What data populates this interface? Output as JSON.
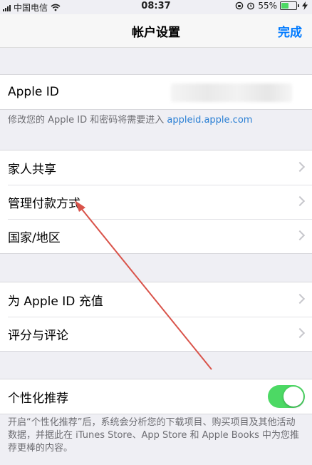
{
  "status": {
    "carrier": "中国电信",
    "time": "08:37",
    "battery": "55%",
    "battery_level": 0.55
  },
  "nav": {
    "title": "帐户设置",
    "done": "完成"
  },
  "apple_id": {
    "label": "Apple ID",
    "note_prefix": "修改您的 Apple ID 和密码将需要进入 ",
    "note_link": "appleid.apple.com"
  },
  "group1": {
    "items": [
      {
        "label": "家人共享"
      },
      {
        "label": "管理付款方式"
      },
      {
        "label": "国家/地区"
      }
    ]
  },
  "group2": {
    "items": [
      {
        "label": "为 Apple ID 充值"
      },
      {
        "label": "评分与评论"
      }
    ]
  },
  "personalized": {
    "label": "个性化推荐",
    "enabled": true,
    "footnote": "开启“个性化推荐”后，系统会分析您的下载项目、购买项目及其他活动数据，并据此在 iTunes Store、App Store 和 Apple Books 中为您推荐更棒的内容。"
  },
  "colors": {
    "accent": "#007aff",
    "toggle_on": "#4cd964",
    "annotation_arrow": "#d9534a"
  }
}
